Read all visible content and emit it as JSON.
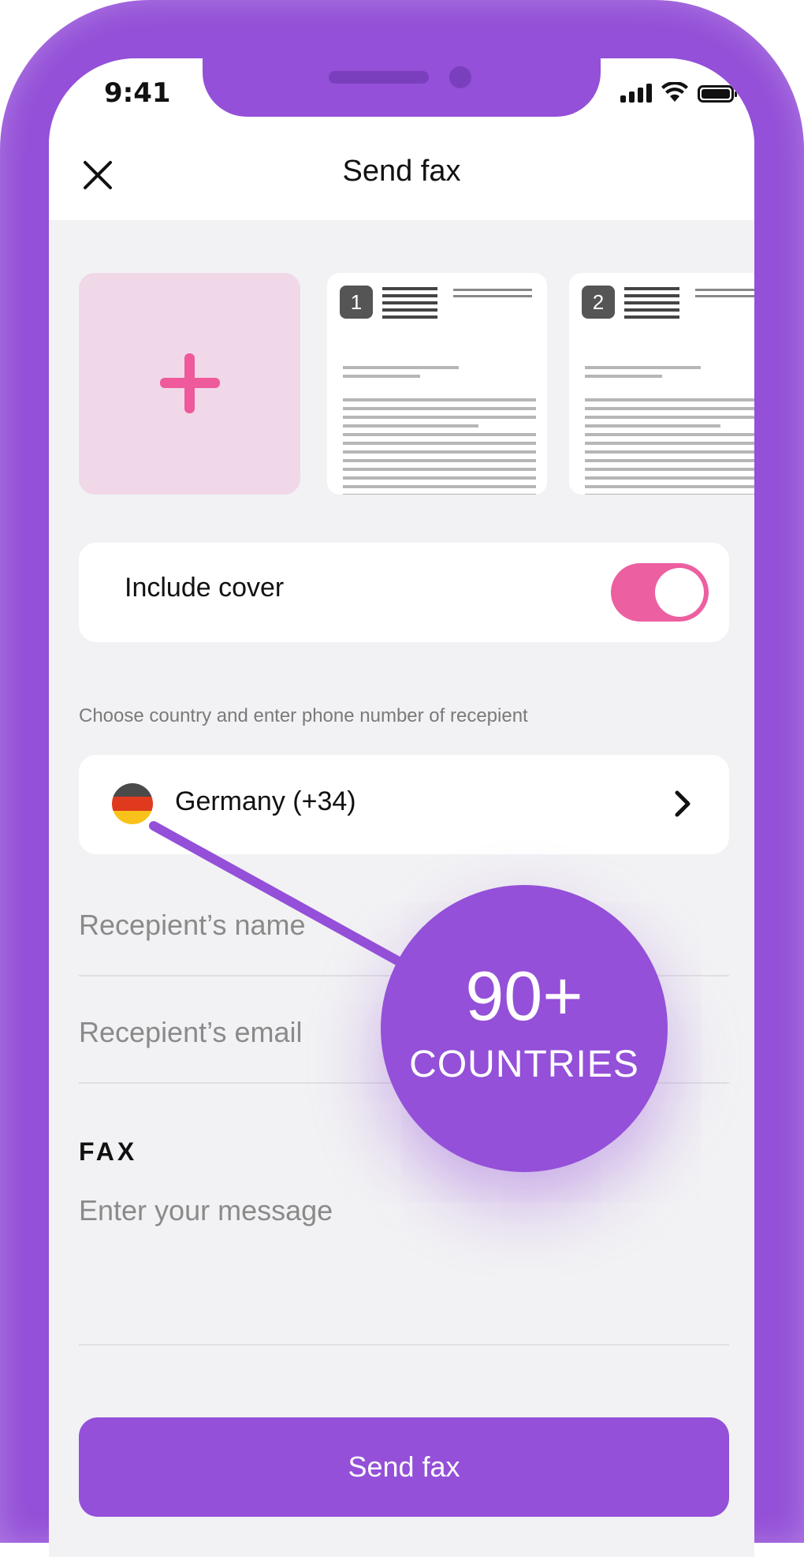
{
  "status_bar": {
    "time": "9:41"
  },
  "header": {
    "title": "Send fax",
    "close_icon": "close-icon"
  },
  "attachments": {
    "add_icon": "plus-icon",
    "documents": [
      {
        "number": "1"
      },
      {
        "number": "2"
      }
    ]
  },
  "cover": {
    "label": "Include cover",
    "enabled": true
  },
  "recipient": {
    "hint": "Choose country and enter phone number of recepient",
    "country_label": "Germany (+34)",
    "flag_colors": [
      "#4a4a4a",
      "#e03a1e",
      "#f9c21a"
    ],
    "name_placeholder": "Recepient’s name",
    "email_placeholder": "Recepient’s email"
  },
  "fax": {
    "label": "FAX",
    "message_placeholder": "Enter your message"
  },
  "send_button": {
    "label": "Send fax"
  },
  "promo": {
    "big": "90+",
    "small": "COUNTRIES"
  },
  "colors": {
    "accent": "#9450d8",
    "pink": "#ec5fa0",
    "tile": "#f0d8e8"
  }
}
